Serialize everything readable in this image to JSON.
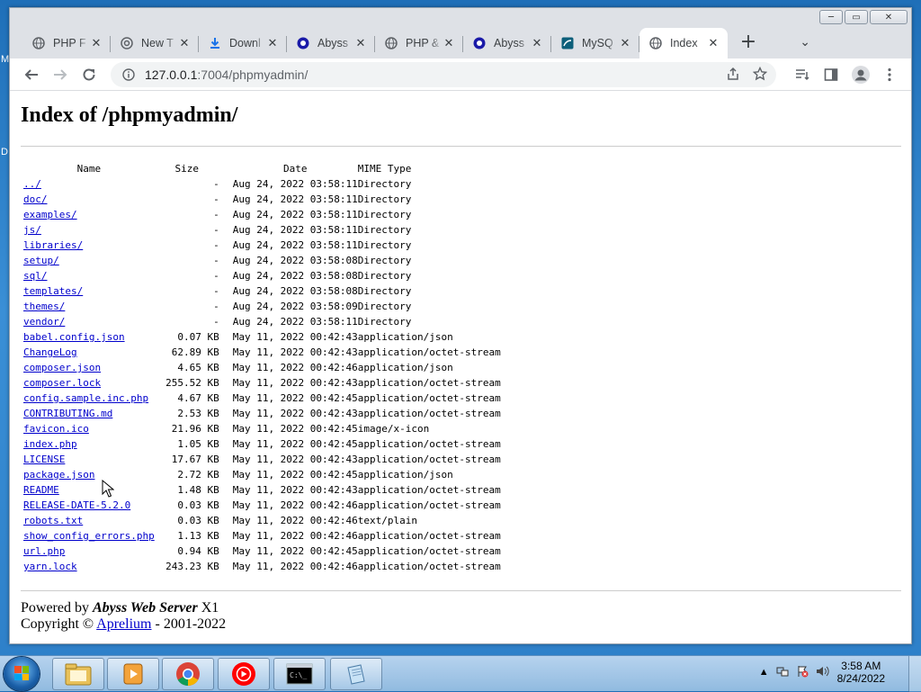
{
  "desktop": {
    "frag_top": "M",
    "frag_mid": "D"
  },
  "window": {
    "controls": {
      "minimize": "─",
      "maximize": "▭",
      "close": "✕"
    }
  },
  "tabs": [
    {
      "title": "PHP F",
      "icon": "globe-icon"
    },
    {
      "title": "New T",
      "icon": "chrome-icon"
    },
    {
      "title": "Downl",
      "icon": "download-icon"
    },
    {
      "title": "Abyss",
      "icon": "abyss-icon"
    },
    {
      "title": "PHP &",
      "icon": "globe-icon"
    },
    {
      "title": "Abyss",
      "icon": "abyss-icon"
    },
    {
      "title": "MySQ",
      "icon": "mysql-icon"
    },
    {
      "title": "Index",
      "icon": "globe-icon",
      "active": true
    }
  ],
  "toolbar": {
    "url_host": "127.0.0.1",
    "url_path": ":7004/phpmyadmin/"
  },
  "page": {
    "heading": "Index of /phpmyadmin/",
    "columns": {
      "name": "Name",
      "size": "Size",
      "date": "Date",
      "mime": "MIME Type"
    },
    "rows": [
      {
        "name": "../",
        "size": "-",
        "date": "Aug 24, 2022 03:58:11",
        "mime": "Directory"
      },
      {
        "name": "doc/",
        "size": "-",
        "date": "Aug 24, 2022 03:58:11",
        "mime": "Directory"
      },
      {
        "name": "examples/",
        "size": "-",
        "date": "Aug 24, 2022 03:58:11",
        "mime": "Directory"
      },
      {
        "name": "js/",
        "size": "-",
        "date": "Aug 24, 2022 03:58:11",
        "mime": "Directory"
      },
      {
        "name": "libraries/",
        "size": "-",
        "date": "Aug 24, 2022 03:58:11",
        "mime": "Directory"
      },
      {
        "name": "setup/",
        "size": "-",
        "date": "Aug 24, 2022 03:58:08",
        "mime": "Directory"
      },
      {
        "name": "sql/",
        "size": "-",
        "date": "Aug 24, 2022 03:58:08",
        "mime": "Directory"
      },
      {
        "name": "templates/",
        "size": "-",
        "date": "Aug 24, 2022 03:58:08",
        "mime": "Directory"
      },
      {
        "name": "themes/",
        "size": "-",
        "date": "Aug 24, 2022 03:58:09",
        "mime": "Directory"
      },
      {
        "name": "vendor/",
        "size": "-",
        "date": "Aug 24, 2022 03:58:11",
        "mime": "Directory"
      },
      {
        "name": "babel.config.json",
        "size": "0.07 KB",
        "date": "May 11, 2022 00:42:43",
        "mime": "application/json"
      },
      {
        "name": "ChangeLog",
        "size": "62.89 KB",
        "date": "May 11, 2022 00:42:43",
        "mime": "application/octet-stream"
      },
      {
        "name": "composer.json",
        "size": "4.65 KB",
        "date": "May 11, 2022 00:42:46",
        "mime": "application/json"
      },
      {
        "name": "composer.lock",
        "size": "255.52 KB",
        "date": "May 11, 2022 00:42:43",
        "mime": "application/octet-stream"
      },
      {
        "name": "config.sample.inc.php",
        "size": "4.67 KB",
        "date": "May 11, 2022 00:42:45",
        "mime": "application/octet-stream"
      },
      {
        "name": "CONTRIBUTING.md",
        "size": "2.53 KB",
        "date": "May 11, 2022 00:42:43",
        "mime": "application/octet-stream"
      },
      {
        "name": "favicon.ico",
        "size": "21.96 KB",
        "date": "May 11, 2022 00:42:45",
        "mime": "image/x-icon"
      },
      {
        "name": "index.php",
        "size": "1.05 KB",
        "date": "May 11, 2022 00:42:45",
        "mime": "application/octet-stream"
      },
      {
        "name": "LICENSE",
        "size": "17.67 KB",
        "date": "May 11, 2022 00:42:43",
        "mime": "application/octet-stream"
      },
      {
        "name": "package.json",
        "size": "2.72 KB",
        "date": "May 11, 2022 00:42:45",
        "mime": "application/json"
      },
      {
        "name": "README",
        "size": "1.48 KB",
        "date": "May 11, 2022 00:42:43",
        "mime": "application/octet-stream"
      },
      {
        "name": "RELEASE-DATE-5.2.0",
        "size": "0.03 KB",
        "date": "May 11, 2022 00:42:46",
        "mime": "application/octet-stream"
      },
      {
        "name": "robots.txt",
        "size": "0.03 KB",
        "date": "May 11, 2022 00:42:46",
        "mime": "text/plain"
      },
      {
        "name": "show_config_errors.php",
        "size": "1.13 KB",
        "date": "May 11, 2022 00:42:46",
        "mime": "application/octet-stream"
      },
      {
        "name": "url.php",
        "size": "0.94 KB",
        "date": "May 11, 2022 00:42:45",
        "mime": "application/octet-stream"
      },
      {
        "name": "yarn.lock",
        "size": "243.23 KB",
        "date": "May 11, 2022 00:42:46",
        "mime": "application/octet-stream"
      }
    ],
    "footer": {
      "powered_prefix": "Powered by ",
      "server_name": "Abyss Web Server",
      "server_suffix": " X1",
      "copyright_prefix": "Copyright © ",
      "company": "Aprelium",
      "years": " - 2001-2022"
    }
  },
  "taskbar": {
    "apps": [
      "explorer-icon",
      "media-player-icon",
      "chrome-icon",
      "youtube-music-icon",
      "cmd-icon",
      "notepad-icon"
    ],
    "clock_time": "3:58 AM",
    "clock_date": "8/24/2022"
  },
  "colors": {
    "link": "#0000cc",
    "taskbar": "#a9cbe9",
    "desktop": "#2d7fc8"
  }
}
